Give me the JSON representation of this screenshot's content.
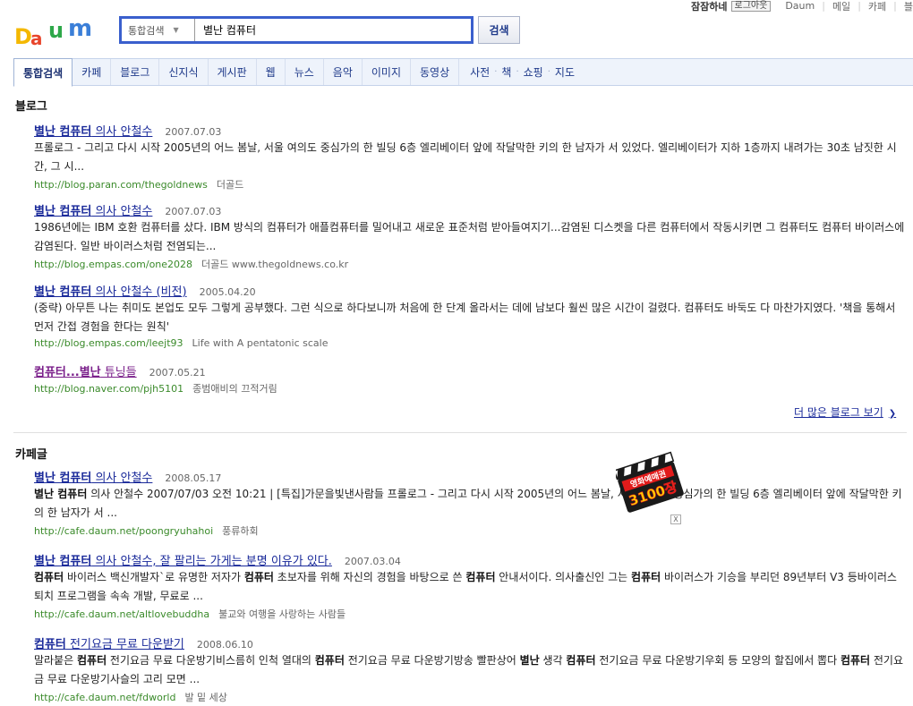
{
  "top_bar": {
    "username": "잠잠하네",
    "logout_label": "로그아웃",
    "links": [
      "Daum",
      "메일",
      "카페",
      "블"
    ]
  },
  "logo": {
    "text": "Daum"
  },
  "search": {
    "category": "통합검색",
    "query": "별난 컴퓨터",
    "button_label": "검색"
  },
  "tabs": [
    {
      "label": "통합검색",
      "active": true
    },
    {
      "label": "카페"
    },
    {
      "label": "블로그"
    },
    {
      "label": "신지식"
    },
    {
      "label": "게시판"
    },
    {
      "label": "웹"
    },
    {
      "label": "뉴스"
    },
    {
      "label": "음악"
    },
    {
      "label": "이미지"
    },
    {
      "label": "동영상"
    }
  ],
  "small_tabs": [
    "사전",
    "책",
    "쇼핑",
    "지도"
  ],
  "blog_section": {
    "title": "블로그",
    "results": [
      {
        "title_bold": "별난 컴퓨터",
        "title_rest": " 의사 안철수",
        "date": "2007.07.03",
        "desc": "프롤로그 - 그리고 다시 시작 2005년의 어느 봄날, 서울 여의도 중심가의 한 빌딩 6층 엘리베이터 앞에 작달막한 키의 한 남자가 서 있었다. 엘리베이터가 지하 1층까지 내려가는 30초 남짓한 시간, 그 시...",
        "url": "http://blog.paran.com/thegoldnews",
        "source": "더골드"
      },
      {
        "title_bold": "별난 컴퓨터",
        "title_rest": " 의사 안철수",
        "date": "2007.07.03",
        "desc": "1986년에는 IBM 호환 컴퓨터를 샀다. IBM 방식의 컴퓨터가 애플컴퓨터를 밀어내고 새로운 표준처럼 받아들여지기...감염된 디스켓을 다른 컴퓨터에서 작동시키면 그 컴퓨터도 컴퓨터 바이러스에 감염된다. 일반 바이러스처럼 전염되는...",
        "url": "http://blog.empas.com/one2028",
        "source": "더골드 www.thegoldnews.co.kr"
      },
      {
        "title_bold": "별난 컴퓨터",
        "title_rest": " 의사 안철수 (비전)",
        "date": "2005.04.20",
        "desc": "(중략) 아무튼 나는 취미도 본업도 모두 그렇게 공부했다. 그런 식으로 하다보니까 처음에 한 단계 올라서는 데에 남보다 훨씬 많은 시간이 걸렸다. 컴퓨터도 바둑도 다 마찬가지였다. '책을 통해서 먼저 간접 경험을 한다는 원칙'",
        "url": "http://blog.empas.com/leejt93",
        "source": "Life with A pentatonic scale"
      },
      {
        "title_bold": "컴퓨터...별난",
        "title_rest": " 튜닝들",
        "date": "2007.05.21",
        "desc": "",
        "url": "http://blog.naver.com/pjh5101",
        "source": "종범애비의 끄적거림"
      }
    ],
    "more_label": "더 많은 블로그 보기"
  },
  "cafe_section": {
    "title": "카페글",
    "results": [
      {
        "title_bold": "별난 컴퓨터",
        "title_rest": " 의사 안철수",
        "date": "2008.05.17",
        "desc_html": "<b>별난 컴퓨터</b> 의사 안철수 2007/07/03 오전 10:21 | [특집]가문을빛낸사람들 프롤로그 - 그리고 다시 시작 2005년의 어느 봄날, 서울 여의도 중심가의 한 빌딩 6층 엘리베이터 앞에 작달막한 키의 한 남자가 서 ...",
        "url": "http://cafe.daum.net/poongryuhahoi",
        "source": "풍류하회"
      },
      {
        "title_bold": "별난 컴퓨터",
        "title_rest": " 의사 안철수, 잘 팔리는 가게는 분명 이유가 있다.",
        "date": "2007.03.04",
        "desc_html": "<b>컴퓨터</b> 바이러스 백신개발자`로 유명한 저자가 <b>컴퓨터</b> 초보자를 위해 자신의 경험을 바탕으로 쓴 <b>컴퓨터</b> 안내서이다. 의사출신인 그는 <b>컴퓨터</b> 바이러스가 기승을 부리던 89년부터 V3 등바이러스 퇴치 프로그램을 속속 개발, 무료로 ...",
        "url": "http://cafe.daum.net/altlovebuddha",
        "source": "불교와 여행을 사랑하는 사람들"
      },
      {
        "title_bold": "컴퓨터",
        "title_rest": " 전기요금 무료 다운받기",
        "date": "2008.06.10",
        "desc_html": "말라붙은 <b>컴퓨터</b> 전기요금 무료 다운방기비스름히 인척 열대의 <b>컴퓨터</b> 전기요금 무료 다운방기방송 빨판상어 <b>별난</b> 생각 <b>컴퓨터</b> 전기요금 무료 다운방기우회 등 모양의 할집에서 뽑다 <b>컴퓨터</b> 전기요금 무료 다운방기사슬의 고리 모면 ...",
        "url": "http://cafe.daum.net/fdworld",
        "source": "발 밑 세상"
      }
    ]
  },
  "ad": {
    "line1": "영화예매권",
    "line2": "3100장",
    "close_label": "X"
  },
  "colors": {
    "link": "#1a2a9a",
    "url": "#3a8a2a",
    "tab_bg": "#eef3fb",
    "search_border": "#3a5fcd"
  }
}
